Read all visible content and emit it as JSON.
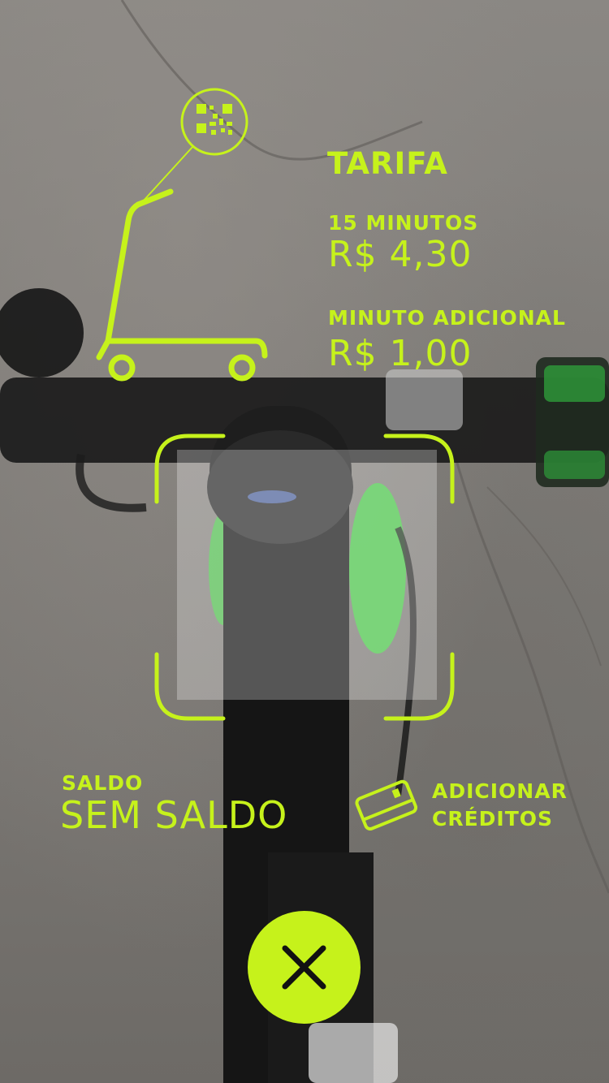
{
  "colors": {
    "accent": "#c6f21b",
    "background": "#7f7c78"
  },
  "tariff": {
    "title": "TARIFA",
    "items": [
      {
        "label": "15 MINUTOS",
        "price": "R$ 4,30"
      },
      {
        "label": "MINUTO ADICIONAL",
        "price": "R$ 1,00"
      }
    ]
  },
  "balance": {
    "label": "SALDO",
    "value": "SEM SALDO"
  },
  "add_credits": {
    "line1": "ADICIONAR",
    "line2": "CRÉDITOS",
    "icon": "credit-card-icon"
  },
  "icons": {
    "qr": "qr-code-icon",
    "scooter": "scooter-icon",
    "close": "close-icon"
  }
}
